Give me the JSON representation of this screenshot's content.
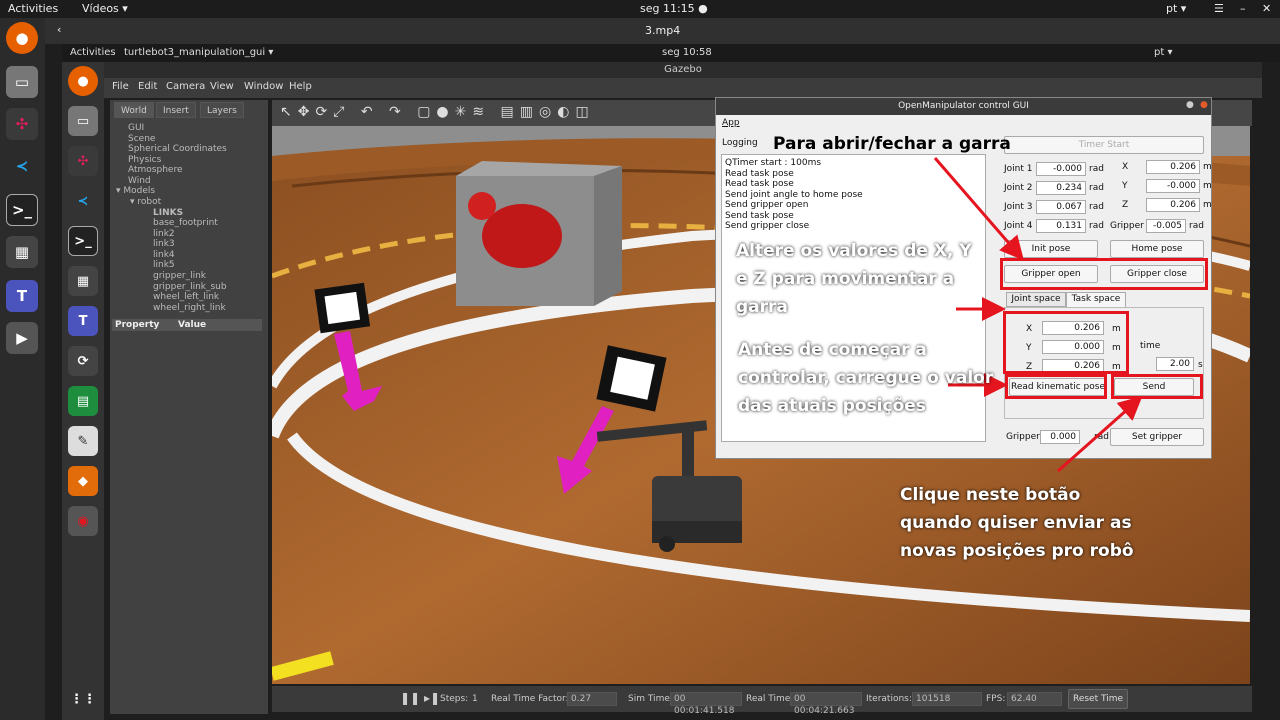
{
  "outer_topbar": {
    "activities": "Activities",
    "app": "Vídeos ▾",
    "clock": "seg 11:15 ●",
    "lang": "pt ▾"
  },
  "video_header": {
    "title": "3.mp4"
  },
  "inner_topbar": {
    "activities": "Activities",
    "app": "turtlebot3_manipulation_gui ▾",
    "clock": "seg 10:58",
    "lang": "pt ▾"
  },
  "gazebo": {
    "title": "Gazebo",
    "menu": [
      "File",
      "Edit",
      "Camera",
      "View",
      "Window",
      "Help"
    ],
    "tabs": [
      "World",
      "Insert",
      "Layers"
    ],
    "tree": [
      "GUI",
      "Scene",
      "Spherical Coordinates",
      "Physics",
      "Atmosphere",
      "Wind",
      "▾ Models",
      "▾ robot",
      "LINKS",
      "base_footprint",
      "link2",
      "link3",
      "link4",
      "link5",
      "gripper_link",
      "gripper_link_sub",
      "wheel_left_link",
      "wheel_right_link"
    ],
    "property_header": "Property",
    "value_header": "Value",
    "status": {
      "steps_label": "Steps:",
      "steps_value": "1",
      "rtf_label": "Real Time Factor:",
      "rtf_value": "0.27",
      "sim_label": "Sim Time:",
      "sim_value": "00 00:01:41.518",
      "real_label": "Real Time:",
      "real_value": "00 00:04:21.663",
      "iter_label": "Iterations:",
      "iter_value": "101518",
      "fps_label": "FPS:",
      "fps_value": "62.40",
      "reset": "Reset Time"
    }
  },
  "gui": {
    "title": "OpenManipulator control GUI",
    "menu_app": "App",
    "logging_label": "Logging",
    "timer_btn": "Timer Start",
    "log": [
      "QTimer start : 100ms",
      "Read task pose",
      "Read task pose",
      "Send joint angle to home pose",
      "Send gripper open",
      "Send task pose",
      "Send gripper close"
    ],
    "joints": [
      {
        "label": "Joint 1",
        "value": "-0.000",
        "unit": "rad"
      },
      {
        "label": "Joint 2",
        "value": "0.234",
        "unit": "rad"
      },
      {
        "label": "Joint 3",
        "value": "0.067",
        "unit": "rad"
      },
      {
        "label": "Joint 4",
        "value": "0.131",
        "unit": "rad"
      }
    ],
    "pose": [
      {
        "label": "X",
        "value": "0.206",
        "unit": "m"
      },
      {
        "label": "Y",
        "value": "-0.000",
        "unit": "m"
      },
      {
        "label": "Z",
        "value": "0.206",
        "unit": "m"
      },
      {
        "label": "Gripper",
        "value": "-0.005",
        "unit": "rad"
      }
    ],
    "init_pose": "Init pose",
    "home_pose": "Home pose",
    "gripper_open": "Gripper open",
    "gripper_close": "Gripper close",
    "tab_joint": "Joint space",
    "tab_task": "Task space",
    "task": [
      {
        "label": "X",
        "value": "0.206",
        "unit": "m"
      },
      {
        "label": "Y",
        "value": "0.000",
        "unit": "m"
      },
      {
        "label": "Z",
        "value": "0.206",
        "unit": "m"
      }
    ],
    "time_label": "time",
    "time_value": "2.00",
    "time_unit": "s",
    "read_kin": "Read kinematic pose",
    "send": "Send",
    "gripper_label": "Gripper",
    "gripper_value": "0.000",
    "gripper_unit": "rad",
    "set_gripper": "Set gripper"
  },
  "annotations": {
    "a1": "Para abrir/fechar a garra",
    "a2_l1": "Altere os valores de X, Y",
    "a2_l2": "e Z para movimentar a",
    "a2_l3": "garra",
    "a3_l1": "Antes de começar a",
    "a3_l2": "controlar, carregue o valor",
    "a3_l3": "das atuais posições",
    "a4_l1": "Clique neste botão",
    "a4_l2": "quando quiser enviar as",
    "a4_l3": "novas posições pro robô"
  },
  "colors": {
    "annotation_red": "#e5151f",
    "magenta": "#e020c0",
    "floor": "#a2612c"
  }
}
